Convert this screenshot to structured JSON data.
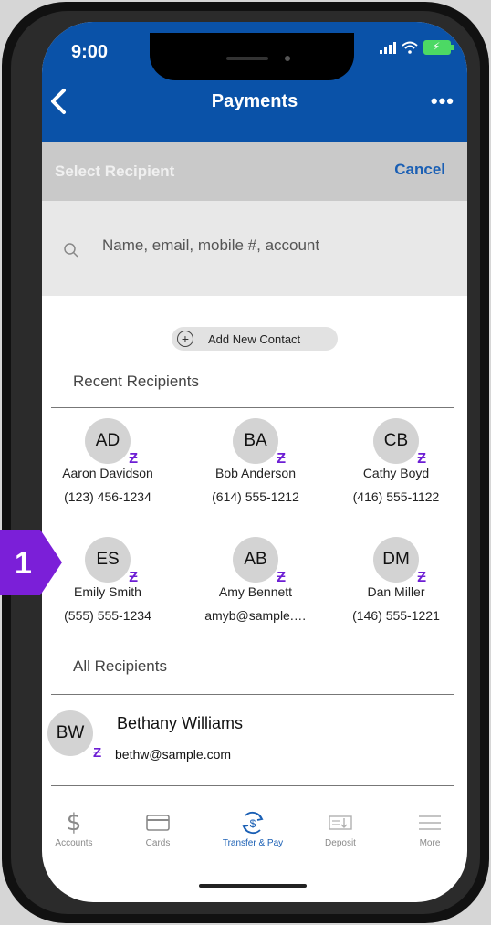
{
  "status": {
    "time": "9:00"
  },
  "header": {
    "title": "Payments",
    "menu_label": "•••"
  },
  "select_bar": {
    "label": "Select Recipient",
    "cancel_label": "Cancel"
  },
  "search": {
    "placeholder": "Name, email, mobile #, account"
  },
  "add_contact": {
    "label": "Add New Contact"
  },
  "recent": {
    "title": "Recent Recipients",
    "items": [
      {
        "initials": "AD",
        "name": "Aaron Davidson",
        "contact": "(123) 456-1234"
      },
      {
        "initials": "BA",
        "name": "Bob Anderson",
        "contact": "(614) 555-1212"
      },
      {
        "initials": "CB",
        "name": "Cathy Boyd",
        "contact": "(416) 555-1122"
      },
      {
        "initials": "ES",
        "name": "Emily Smith",
        "contact": "(555) 555-1234"
      },
      {
        "initials": "AB",
        "name": "Amy Bennett",
        "contact": "amyb@sample.…"
      },
      {
        "initials": "DM",
        "name": "Dan Miller",
        "contact": "(146) 555-1221"
      }
    ]
  },
  "all": {
    "title": "All Recipients",
    "items": [
      {
        "initials": "BW",
        "name": "Bethany Williams",
        "contact": "bethw@sample.com"
      }
    ]
  },
  "zelle_glyph": "Ƶ",
  "tabs": [
    {
      "label": "Accounts",
      "icon": "dollar-icon"
    },
    {
      "label": "Cards",
      "icon": "card-icon"
    },
    {
      "label": "Transfer & Pay",
      "icon": "transfer-pay-icon"
    },
    {
      "label": "Deposit",
      "icon": "check-deposit-icon"
    },
    {
      "label": "More",
      "icon": "hamburger-icon"
    }
  ],
  "callout": {
    "number": "1"
  },
  "colors": {
    "header_blue": "#0a52a8",
    "zelle_purple": "#6d1ed4",
    "callout_purple": "#7b1fd8",
    "link_blue": "#1a5fb4"
  }
}
